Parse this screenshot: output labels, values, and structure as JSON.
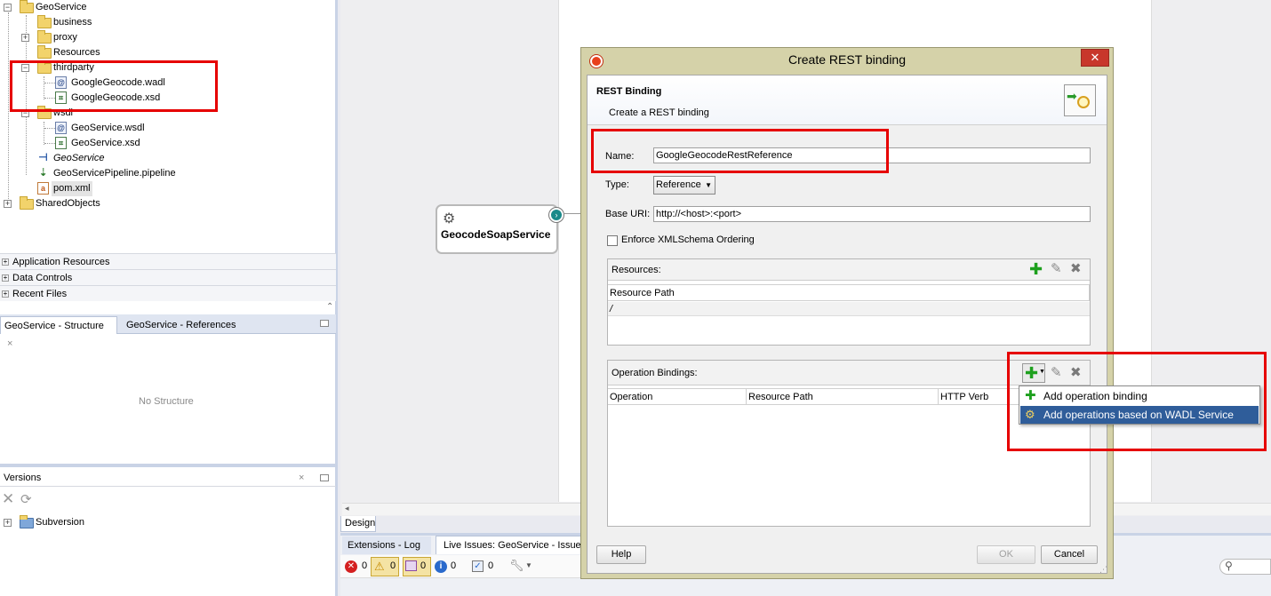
{
  "project_tree": {
    "root": "GeoService",
    "items": [
      {
        "label": "business"
      },
      {
        "label": "proxy"
      },
      {
        "label": "Resources"
      },
      {
        "label": "thirdparty"
      },
      {
        "label": "GoogleGeocode.wadl"
      },
      {
        "label": "GoogleGeocode.xsd"
      },
      {
        "label": "wsdl"
      },
      {
        "label": "GeoService.wsdl"
      },
      {
        "label": "GeoService.xsd"
      },
      {
        "label": "GeoService"
      },
      {
        "label": "GeoServicePipeline.pipeline"
      },
      {
        "label": "pom.xml"
      },
      {
        "label": "SharedObjects"
      }
    ]
  },
  "accordion": {
    "app_resources": "Application Resources",
    "data_controls": "Data Controls",
    "recent_files": "Recent Files"
  },
  "structure_panel": {
    "tab_structure": "GeoService - Structure",
    "tab_references": "GeoService - References",
    "empty_text": "No Structure"
  },
  "versions_panel": {
    "title": "Versions",
    "subversion": "Subversion"
  },
  "canvas": {
    "service_name": "GeocodeSoapService",
    "design_tab": "Design"
  },
  "dialog": {
    "title": "Create REST binding",
    "heading": "REST Binding",
    "subheading": "Create a REST binding",
    "name_label": "Name:",
    "name_value": "GoogleGeocodeRestReference",
    "type_label": "Type:",
    "type_value": "Reference",
    "base_uri_label": "Base URI:",
    "base_uri_value": "http://<host>:<port>",
    "enforce_label": "Enforce XMLSchema Ordering",
    "resources_label": "Resources:",
    "resource_path_header": "Resource Path",
    "resource_row": "/",
    "operation_bindings_label": "Operation Bindings:",
    "op_headers": [
      "Operation",
      "Resource Path",
      "HTTP Verb"
    ],
    "help_button": "Help",
    "ok_button": "OK",
    "cancel_button": "Cancel"
  },
  "add_menu": {
    "items": [
      "Add operation binding",
      "Add operations based on WADL Service"
    ]
  },
  "bottom": {
    "tab_extensions_log": "Extensions - Log",
    "tab_live_issues": "Live Issues: GeoService - Issue",
    "counts": [
      "0",
      "0",
      "0",
      "0",
      "0"
    ]
  },
  "colors": {
    "highlight_red": "#e60000",
    "menu_selected": "#2f5d9a",
    "dialog_frame": "#d5d2a9",
    "add_green": "#1ea01e"
  }
}
